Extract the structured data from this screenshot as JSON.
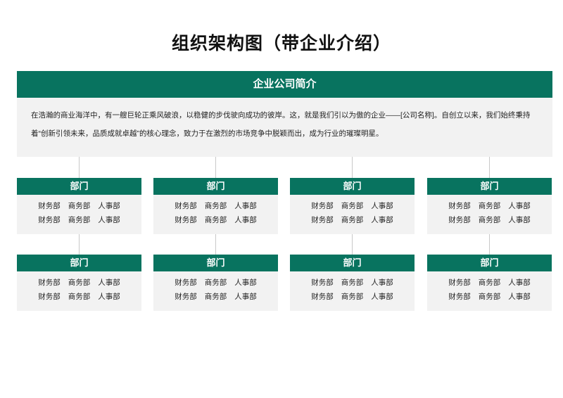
{
  "title": "组织架构图（带企业介绍）",
  "intro": {
    "header": "企业公司简介",
    "text": "在浩瀚的商业海洋中，有一艘巨轮正乘风破浪，以稳健的步伐驶向成功的彼岸。这，就是我们引以为傲的企业——[公司名称]。自创立以来，我们始终秉持着“创新引领未来，品质成就卓越”的核心理念，致力于在激烈的市场竞争中脱颖而出，成为行业的璀璨明星。"
  },
  "departments": [
    {
      "label": "部门",
      "rows": [
        [
          "财务部",
          "商务部",
          "人事部"
        ],
        [
          "财务部",
          "商务部",
          "人事部"
        ]
      ]
    },
    {
      "label": "部门",
      "rows": [
        [
          "财务部",
          "商务部",
          "人事部"
        ],
        [
          "财务部",
          "商务部",
          "人事部"
        ]
      ]
    },
    {
      "label": "部门",
      "rows": [
        [
          "财务部",
          "商务部",
          "人事部"
        ],
        [
          "财务部",
          "商务部",
          "人事部"
        ]
      ]
    },
    {
      "label": "部门",
      "rows": [
        [
          "财务部",
          "商务部",
          "人事部"
        ],
        [
          "财务部",
          "商务部",
          "人事部"
        ]
      ]
    },
    {
      "label": "部门",
      "rows": [
        [
          "财务部",
          "商务部",
          "人事部"
        ],
        [
          "财务部",
          "商务部",
          "人事部"
        ]
      ]
    },
    {
      "label": "部门",
      "rows": [
        [
          "财务部",
          "商务部",
          "人事部"
        ],
        [
          "财务部",
          "商务部",
          "人事部"
        ]
      ]
    },
    {
      "label": "部门",
      "rows": [
        [
          "财务部",
          "商务部",
          "人事部"
        ],
        [
          "财务部",
          "商务部",
          "人事部"
        ]
      ]
    },
    {
      "label": "部门",
      "rows": [
        [
          "财务部",
          "商务部",
          "人事部"
        ],
        [
          "财务部",
          "商务部",
          "人事部"
        ]
      ]
    }
  ],
  "colors": {
    "header": "#08735f",
    "panel": "#f2f2f2",
    "connector": "#c8c8c8"
  }
}
